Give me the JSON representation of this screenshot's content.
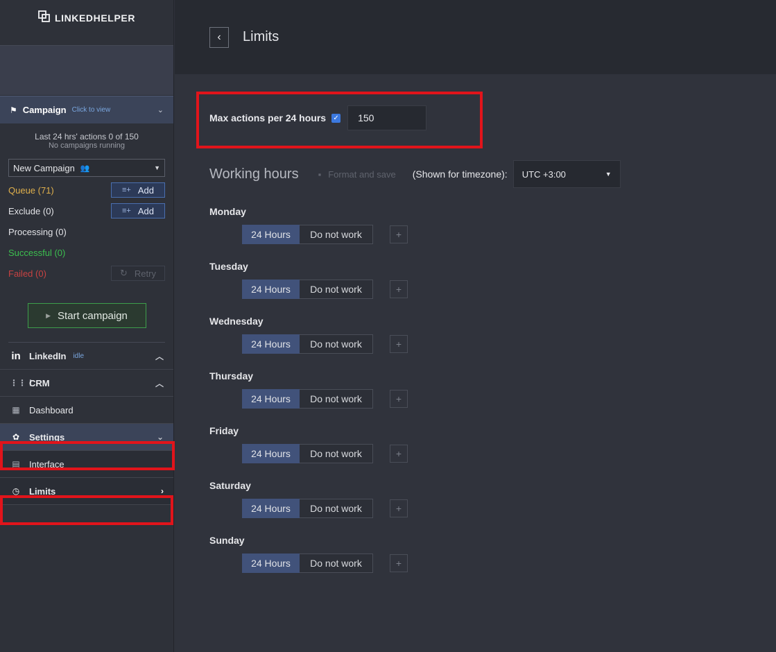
{
  "app": {
    "logo_text": "LINKEDHELPER"
  },
  "sidebar": {
    "campaign": {
      "title": "Campaign",
      "click_label": "Click to view",
      "stat_line": "Last 24 hrs' actions 0 of 150",
      "stat_sub": "No campaigns running",
      "selected": "New Campaign",
      "queue_label": "Queue (71)",
      "exclude_label": "Exclude (0)",
      "processing_label": "Processing (0)",
      "successful_label": "Successful (0)",
      "failed_label": "Failed (0)",
      "add_label": "Add",
      "retry_label": "Retry",
      "start_label": "Start campaign"
    },
    "nav": {
      "linkedin": "LinkedIn",
      "linkedin_status": "idle",
      "crm": "CRM",
      "dashboard": "Dashboard",
      "settings": "Settings",
      "interface": "Interface",
      "limits": "Limits"
    }
  },
  "header": {
    "title": "Limits"
  },
  "limits": {
    "max_label": "Max actions per 24 hours",
    "max_enabled": true,
    "max_value": "150"
  },
  "working_hours": {
    "title": "Working hours",
    "format_save": "Format and save",
    "tz_label": "(Shown for timezone):",
    "tz_value": "UTC +3:00",
    "on_label": "24 Hours",
    "off_label": "Do not work",
    "days": [
      "Monday",
      "Tuesday",
      "Wednesday",
      "Thursday",
      "Friday",
      "Saturday",
      "Sunday"
    ]
  },
  "colors": {
    "accent_blue": "#3c79e0",
    "highlight_red": "#e1141b",
    "queue_yellow": "#e0b04c",
    "success_green": "#3cbf4f",
    "failed_red": "#c84242"
  }
}
